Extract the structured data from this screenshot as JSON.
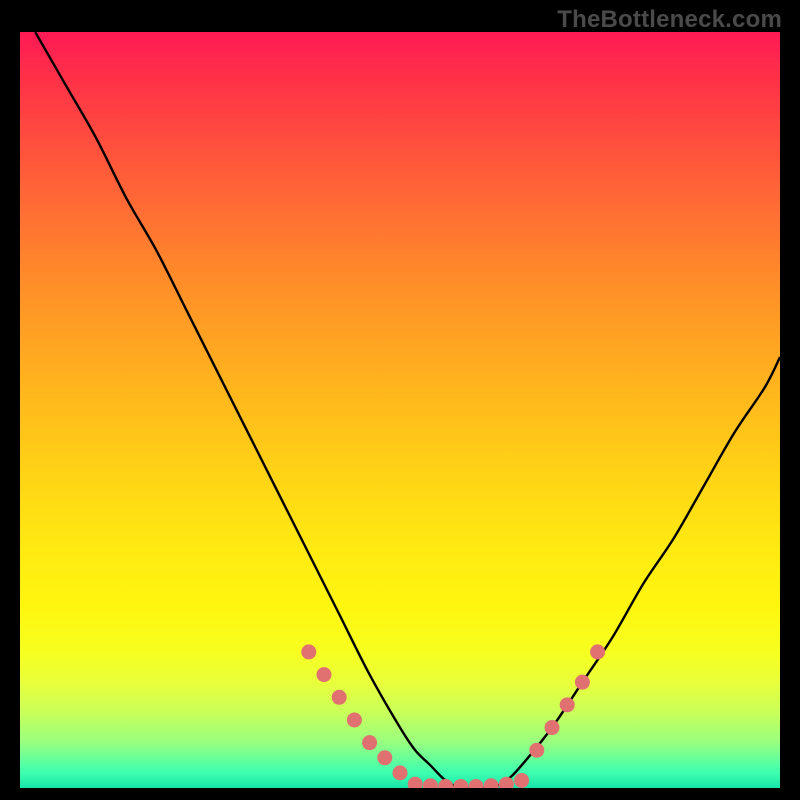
{
  "watermark": "TheBottleneck.com",
  "chart_data": {
    "type": "line",
    "title": "",
    "xlabel": "",
    "ylabel": "",
    "xlim": [
      0,
      100
    ],
    "ylim": [
      0,
      100
    ],
    "grid": false,
    "legend": false,
    "series": [
      {
        "name": "bottleneck-curve",
        "color": "#000000",
        "x": [
          2,
          6,
          10,
          14,
          18,
          22,
          26,
          30,
          34,
          38,
          42,
          46,
          50,
          52,
          54,
          56,
          58,
          60,
          62,
          64,
          66,
          70,
          74,
          78,
          82,
          86,
          90,
          94,
          98,
          100
        ],
        "y": [
          100,
          93,
          86,
          78,
          71,
          63,
          55,
          47,
          39,
          31,
          23,
          15,
          8,
          5,
          3,
          1,
          0,
          0,
          0,
          1,
          3,
          8,
          14,
          20,
          27,
          33,
          40,
          47,
          53,
          57
        ]
      },
      {
        "name": "highlight-dots-left",
        "color": "#e17070",
        "style": "markers",
        "x": [
          38,
          40,
          42,
          44,
          46,
          48,
          50
        ],
        "y": [
          18,
          15,
          12,
          9,
          6,
          4,
          2
        ]
      },
      {
        "name": "highlight-dots-bottom",
        "color": "#e17070",
        "style": "markers",
        "x": [
          52,
          54,
          56,
          58,
          60,
          62,
          64,
          66
        ],
        "y": [
          0.5,
          0.3,
          0.2,
          0.2,
          0.2,
          0.3,
          0.5,
          1
        ]
      },
      {
        "name": "highlight-dots-right",
        "color": "#e17070",
        "style": "markers",
        "x": [
          68,
          70,
          72,
          74,
          76
        ],
        "y": [
          5,
          8,
          11,
          14,
          18
        ]
      }
    ],
    "annotations": []
  },
  "colors": {
    "curve": "#000000",
    "dots": "#e17070",
    "frame": "#000000"
  }
}
